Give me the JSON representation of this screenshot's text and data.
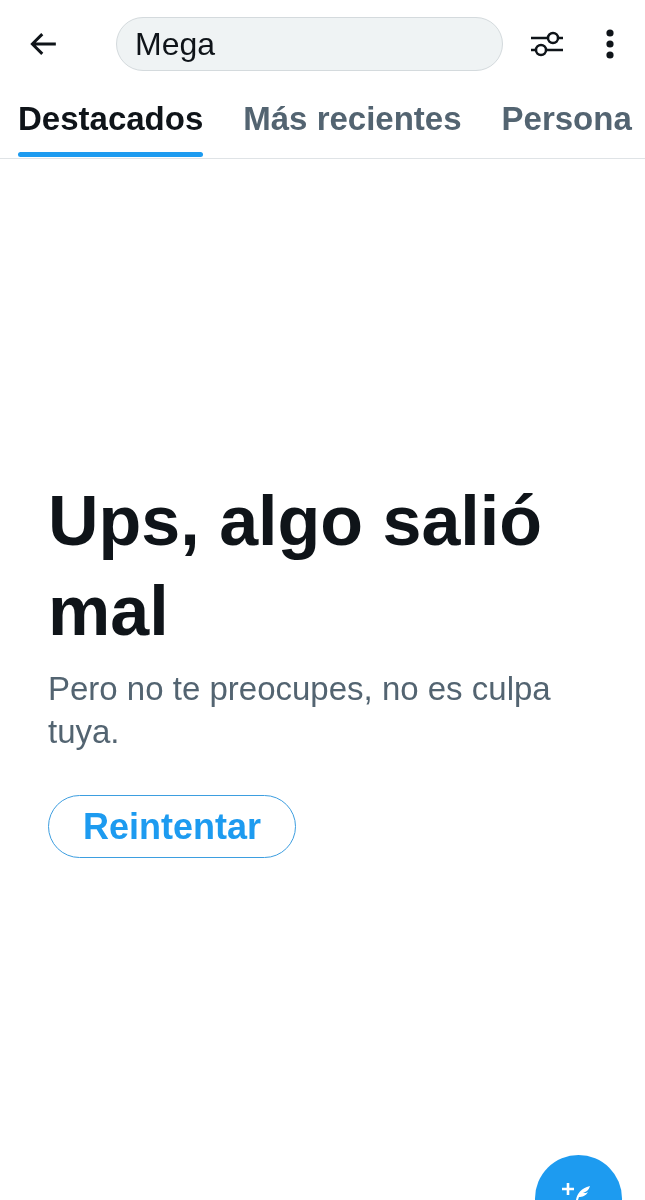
{
  "header": {
    "search": {
      "value": "Mega"
    }
  },
  "tabs": [
    {
      "label": "Destacados",
      "selected": true
    },
    {
      "label": "Más recientes",
      "selected": false
    },
    {
      "label": "Persona",
      "selected": false
    }
  ],
  "error": {
    "title": "Ups, algo salió mal",
    "message": "Pero no te preocupes, no es culpa tuya.",
    "retry_button": "Reintentar"
  }
}
